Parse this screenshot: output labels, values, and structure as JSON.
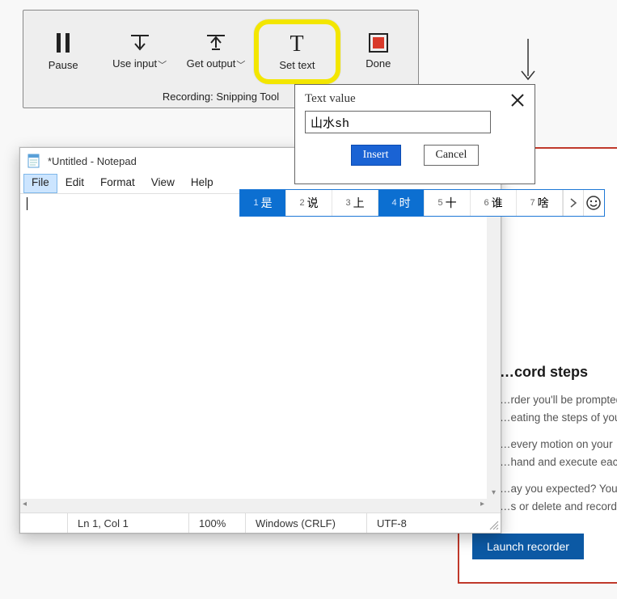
{
  "toolbar": {
    "items": [
      {
        "label": "Pause",
        "has_chevron": false
      },
      {
        "label": "Use input",
        "has_chevron": true
      },
      {
        "label": "Get output",
        "has_chevron": true
      },
      {
        "label": "Set text",
        "has_chevron": false
      },
      {
        "label": "Done",
        "has_chevron": false
      }
    ],
    "footer": "Recording: Snipping Tool"
  },
  "popup": {
    "title": "Text value",
    "input_value": "山水sh",
    "insert_label": "Insert",
    "cancel_label": "Cancel"
  },
  "ime": {
    "candidates": [
      {
        "num": "1",
        "char": "是",
        "selected": true
      },
      {
        "num": "2",
        "char": "说",
        "selected": false
      },
      {
        "num": "3",
        "char": "上",
        "selected": false
      },
      {
        "num": "4",
        "char": "时",
        "selected": true
      },
      {
        "num": "5",
        "char": "十",
        "selected": false
      },
      {
        "num": "6",
        "char": "谁",
        "selected": false
      },
      {
        "num": "7",
        "char": "啥",
        "selected": false
      }
    ]
  },
  "notepad": {
    "title": "*Untitled - Notepad",
    "menus": [
      "File",
      "Edit",
      "Format",
      "View",
      "Help"
    ],
    "active_menu_index": 0,
    "status": {
      "position": "Ln 1, Col 1",
      "zoom": "100%",
      "line_ending": "Windows (CRLF)",
      "encoding": "UTF-8"
    }
  },
  "background_panel": {
    "heading": "…cord steps",
    "p1": "…rder you'll be prompted",
    "p2": "…eating the steps of you",
    "p3": "…every motion on your",
    "p4": "…hand and execute each",
    "p5": "…ay you expected? You c",
    "p6": "…s or delete and record",
    "button": "Launch recorder"
  }
}
